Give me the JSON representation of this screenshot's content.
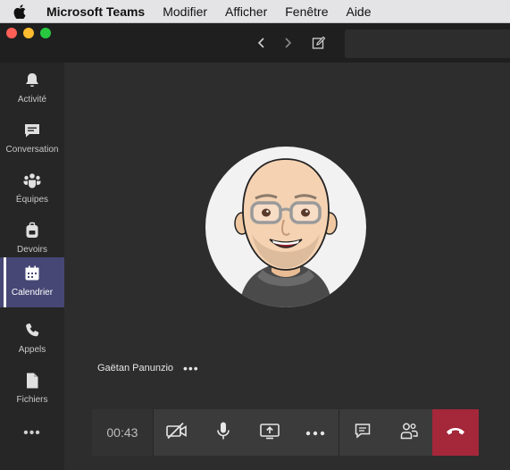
{
  "menubar": {
    "apple_icon": "apple-icon",
    "app_name": "Microsoft Teams",
    "items": [
      "Modifier",
      "Afficher",
      "Fenêtre",
      "Aide"
    ]
  },
  "window": {
    "traffic_lights": {
      "close": "#ff5f57",
      "minimize": "#febc2e",
      "zoom": "#28c840"
    },
    "nav": {
      "back_icon": "chevron-left-icon",
      "forward_icon": "chevron-right-icon",
      "compose_icon": "compose-icon"
    }
  },
  "rail": {
    "items": [
      {
        "label": "Activité",
        "icon": "bell-icon"
      },
      {
        "label": "Conversation",
        "icon": "chat-icon"
      },
      {
        "label": "Équipes",
        "icon": "teams-icon"
      },
      {
        "label": "Devoirs",
        "icon": "backpack-icon"
      },
      {
        "label": "Calendrier",
        "icon": "calendar-icon",
        "active": true
      },
      {
        "label": "Appels",
        "icon": "phone-icon"
      },
      {
        "label": "Fichiers",
        "icon": "file-icon"
      }
    ],
    "more": "•••"
  },
  "call": {
    "participant_name": "Gaëtan Panunzio",
    "participant_more": "•••",
    "timer": "00:43",
    "controls": [
      "camera-off-icon",
      "microphone-icon",
      "share-screen-icon",
      "more-icon",
      "chat-icon",
      "participants-icon",
      "hang-up-icon"
    ],
    "colors": {
      "hang_up": "#a4273a",
      "active_rail": "#464775"
    }
  }
}
